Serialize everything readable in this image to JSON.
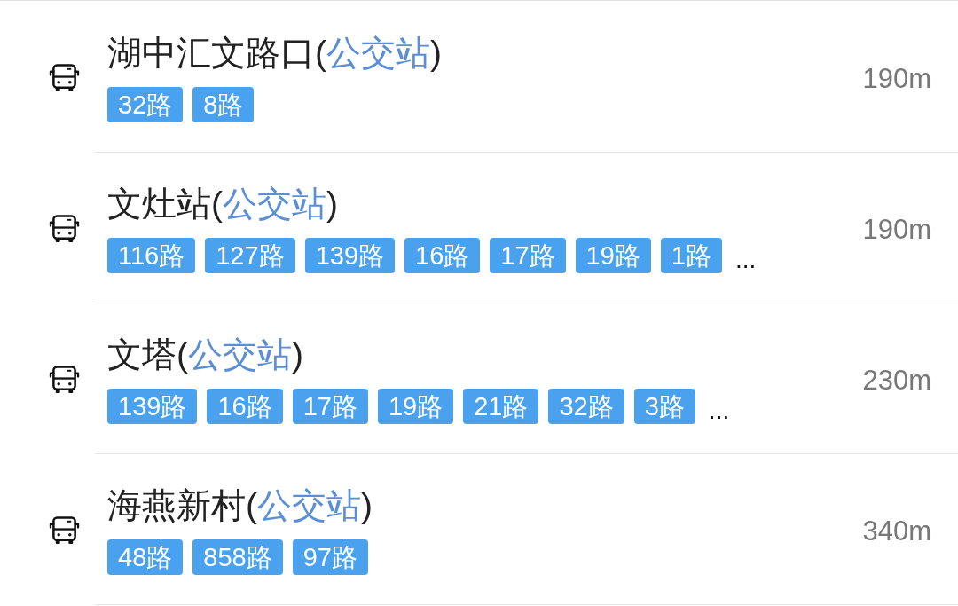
{
  "stops": [
    {
      "title": [
        {
          "kind": "plain",
          "text": "湖中汇文路口("
        },
        {
          "kind": "category",
          "text": "公交站"
        },
        {
          "kind": "plain",
          "text": ")"
        }
      ],
      "routes": [
        "32路",
        "8路"
      ],
      "distance": "190m"
    },
    {
      "title": [
        {
          "kind": "plain",
          "text": "文灶站("
        },
        {
          "kind": "category",
          "text": "公交站"
        },
        {
          "kind": "plain",
          "text": ")"
        }
      ],
      "routes": [
        "116路",
        "127路",
        "139路",
        "16路",
        "17路",
        "19路",
        "1路"
      ],
      "overflow": "...",
      "distance": "190m"
    },
    {
      "title": [
        {
          "kind": "plain",
          "text": "文塔("
        },
        {
          "kind": "category",
          "text": "公交站"
        },
        {
          "kind": "plain",
          "text": ")"
        }
      ],
      "routes": [
        "139路",
        "16路",
        "17路",
        "19路",
        "21路",
        "32路",
        "3路"
      ],
      "overflow": "...",
      "distance": "230m"
    },
    {
      "title": [
        {
          "kind": "plain",
          "text": "海燕新村("
        },
        {
          "kind": "category",
          "text": "公交站"
        },
        {
          "kind": "plain",
          "text": ")"
        }
      ],
      "routes": [
        "48路",
        "858路",
        "97路"
      ],
      "distance": "340m"
    }
  ]
}
